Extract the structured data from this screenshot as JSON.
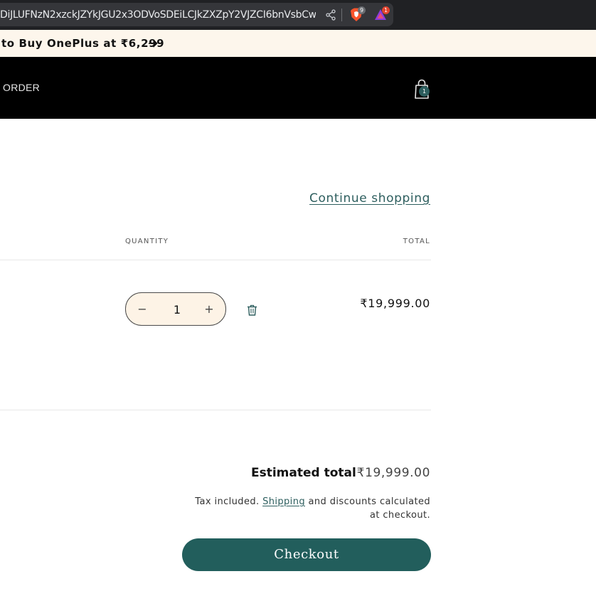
{
  "browser": {
    "url": "DiJLUFNzN2xzckJZYkJGU2x3ODVoSDEiLCJkZXZpY2VJZCI6bnVsbCwi...",
    "brave_shields_count": "9",
    "rewards_count": "1",
    "icons": [
      "share-icon",
      "brave-shields-icon",
      "brave-rewards-icon"
    ]
  },
  "announcement": {
    "text": "to Buy OnePlus at ₹6,299",
    "arrow_icon": "arrow-right-icon"
  },
  "header": {
    "nav_label": "ORDER",
    "cart_count": "1",
    "cart_icon": "shopping-bag-icon"
  },
  "cart": {
    "continue_label": "Continue shopping",
    "columns": {
      "quantity": "QUANTITY",
      "total": "TOTAL"
    },
    "item": {
      "quantity": "1",
      "minus_label": "−",
      "plus_label": "+",
      "line_total": "₹19,999.00"
    },
    "estimated_total_label": "Estimated total",
    "estimated_total_value": "₹19,999.00",
    "tax_prefix": "Tax included.",
    "tax_link": "Shipping",
    "tax_suffix": "and discounts calculated at checkout.",
    "checkout_label": "Checkout"
  },
  "colors": {
    "accent": "#225e5c",
    "announcement_bg": "#fdf6ec",
    "header_bg": "#000000",
    "quantity_bg": "#fdf3e6"
  }
}
